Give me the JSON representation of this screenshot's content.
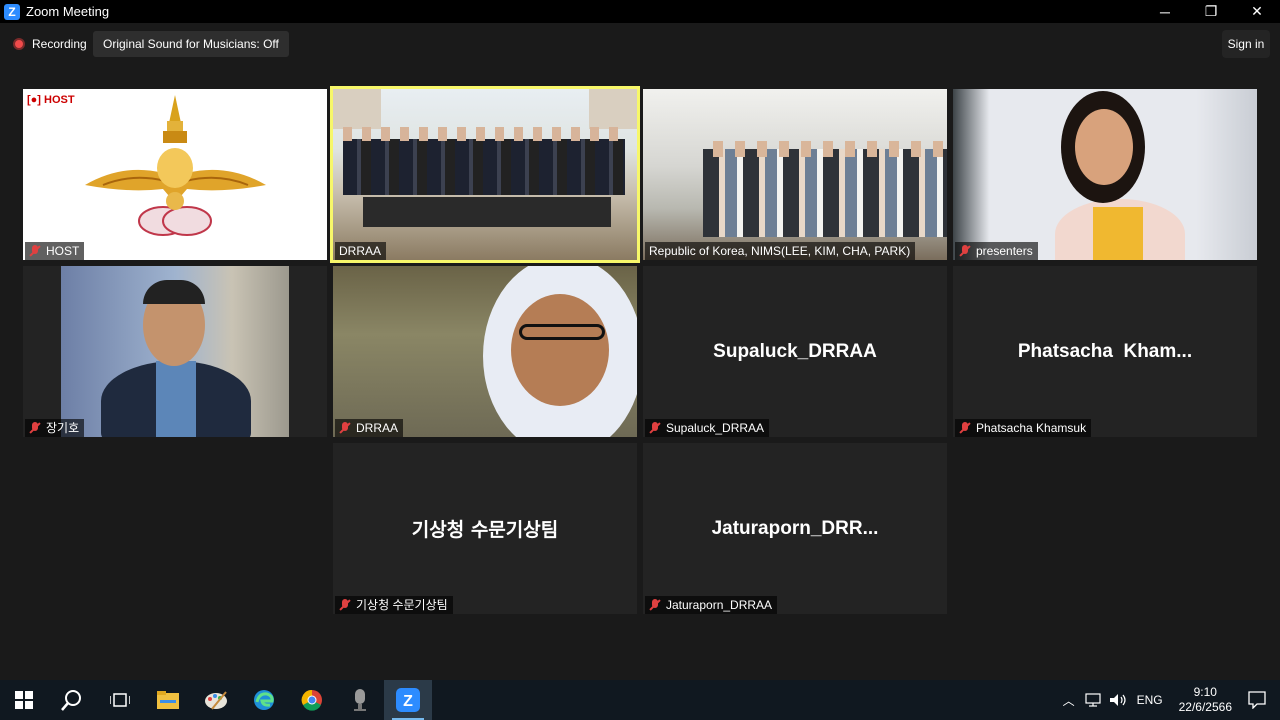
{
  "window": {
    "title": "Zoom Meeting",
    "minimize": "─",
    "restore": "❐",
    "close": "✕"
  },
  "meeting_bar": {
    "recording_label": "Recording",
    "original_sound_label": "Original Sound for Musicians: Off",
    "sign_in_label": "Sign in"
  },
  "tiles": [
    {
      "name": "HOST",
      "host_badge": "[●] HOST",
      "muted": true,
      "type": "emblem"
    },
    {
      "name": "DRRAA",
      "muted": false,
      "type": "video",
      "active_speaker": true
    },
    {
      "name": "Republic of Korea, NIMS(LEE, KIM, CHA, PARK)",
      "muted": false,
      "type": "video"
    },
    {
      "name": "presenters",
      "muted": true,
      "type": "video"
    },
    {
      "name": "장기호",
      "muted": true,
      "type": "video"
    },
    {
      "name": "DRRAA",
      "muted": true,
      "type": "video"
    },
    {
      "name": "Supaluck_DRRAA",
      "display_name": "Supaluck_DRRAA",
      "muted": true,
      "type": "name-only"
    },
    {
      "name": "Phatsacha Khamsuk",
      "display_name": "Phatsacha  Kham...",
      "muted": true,
      "type": "name-only"
    },
    {
      "name": "기상청 수문기상팀",
      "display_name": "기상청 수문기상팀",
      "muted": true,
      "type": "name-only"
    },
    {
      "name": "Jaturaporn_DRRAA",
      "display_name": "Jaturaporn_DRR...",
      "muted": true,
      "type": "name-only"
    }
  ],
  "taskbar": {
    "icons": [
      "windows-start-icon",
      "search-icon",
      "task-view-icon",
      "file-explorer-icon",
      "paint-icon",
      "edge-icon",
      "chrome-icon",
      "voice-recorder-icon",
      "zoom-icon"
    ],
    "language": "ENG",
    "time": "9:10",
    "date": "22/6/2566"
  }
}
